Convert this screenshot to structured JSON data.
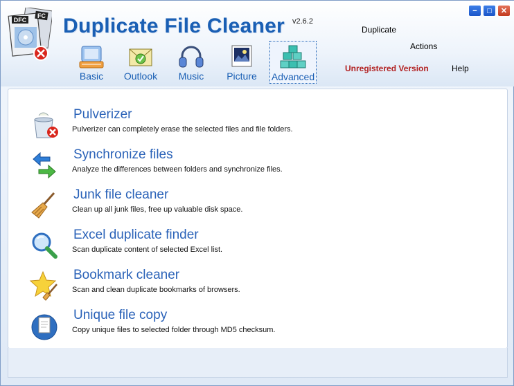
{
  "app": {
    "title": "Duplicate File Cleaner",
    "version": "v2.6.2",
    "logo_text_back": "DFC",
    "logo_text_front": "FC"
  },
  "window_controls": {
    "minimize": "−",
    "maximize": "□",
    "close": "✕"
  },
  "menu": {
    "duplicate": "Duplicate",
    "actions": "Actions",
    "help": "Help",
    "unregistered": "Unregistered Version"
  },
  "tabs": [
    {
      "label": "Basic",
      "icon": "keyboard-icon"
    },
    {
      "label": "Outlook",
      "icon": "envelope-icon"
    },
    {
      "label": "Music",
      "icon": "headphones-icon"
    },
    {
      "label": "Picture",
      "icon": "picture-icon"
    },
    {
      "label": "Advanced",
      "icon": "stacked-cubes-icon",
      "active": true
    }
  ],
  "features": [
    {
      "title": "Pulverizer",
      "desc": "Pulverizer can completely erase the selected files and file folders.",
      "icon": "trash-delete-icon"
    },
    {
      "title": "Synchronize files",
      "desc": "Analyze the differences between folders and synchronize files.",
      "icon": "sync-arrows-icon"
    },
    {
      "title": "Junk file cleaner",
      "desc": "Clean up all junk files, free up valuable disk space.",
      "icon": "broom-icon"
    },
    {
      "title": "Excel duplicate finder",
      "desc": "Scan duplicate content of selected Excel list.",
      "icon": "magnifier-icon"
    },
    {
      "title": "Bookmark cleaner",
      "desc": "Scan and clean duplicate bookmarks of browsers.",
      "icon": "star-broom-icon"
    },
    {
      "title": "Unique file copy",
      "desc": "Copy unique files to selected folder through MD5 checksum.",
      "icon": "file-copy-icon"
    }
  ],
  "colors": {
    "accent": "#1a5fb4",
    "unregistered": "#b22222",
    "feature_title": "#2a62b8"
  }
}
